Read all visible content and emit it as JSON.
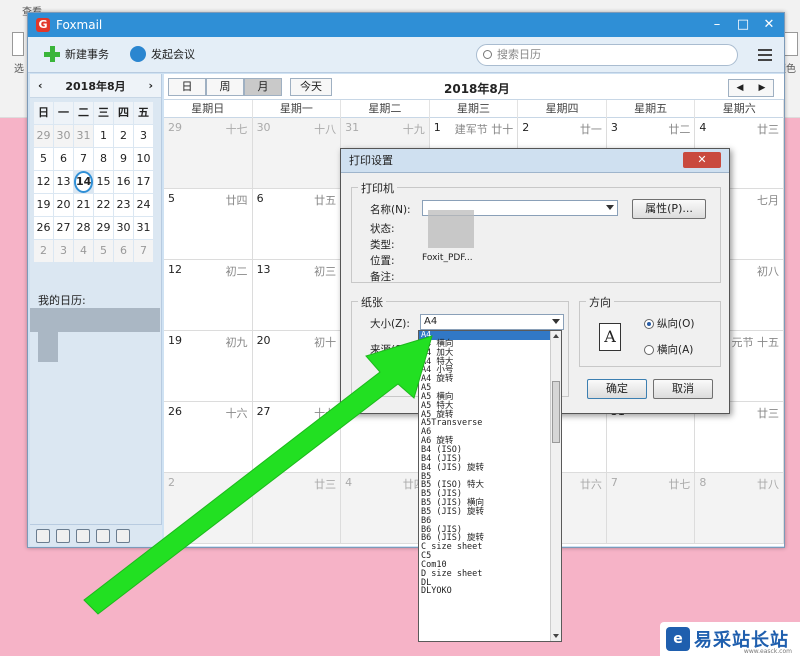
{
  "background_app": {
    "menu_label": "查看",
    "left_label": "选",
    "right_label": "颜色"
  },
  "window": {
    "title": "Foxmail"
  },
  "toolbar": {
    "new_event": "新建事务",
    "start_meeting": "发起会议",
    "search_placeholder": "搜索日历"
  },
  "mini_calendar": {
    "title": "2018年8月",
    "weekdays": [
      "日",
      "一",
      "二",
      "三",
      "四",
      "五",
      "六"
    ],
    "days": [
      [
        "29",
        "30",
        "31",
        "1",
        "2",
        "3",
        "4"
      ],
      [
        "5",
        "6",
        "7",
        "8",
        "9",
        "10",
        "11"
      ],
      [
        "12",
        "13",
        "14",
        "15",
        "16",
        "17",
        "18"
      ],
      [
        "19",
        "20",
        "21",
        "22",
        "23",
        "24",
        "25"
      ],
      [
        "26",
        "27",
        "28",
        "29",
        "30",
        "31",
        "1"
      ],
      [
        "2",
        "3",
        "4",
        "5",
        "6",
        "7",
        "8"
      ]
    ],
    "today": "14"
  },
  "my_calendars_label": "我的日历:",
  "view_bar": {
    "day": "日",
    "week": "周",
    "month": "月",
    "today": "今天",
    "title": "2018年8月"
  },
  "month_view": {
    "weekdays": [
      "星期日",
      "星期一",
      "星期二",
      "星期三",
      "星期四",
      "星期五",
      "星期六"
    ],
    "rows": [
      [
        {
          "d": "29",
          "l": "十七"
        },
        {
          "d": "30",
          "l": "十八"
        },
        {
          "d": "31",
          "l": "十九"
        },
        {
          "d": "1",
          "l": "建军节 廿十"
        },
        {
          "d": "2",
          "l": "廿一"
        },
        {
          "d": "3",
          "l": "廿二"
        },
        {
          "d": "4",
          "l": "廿三"
        }
      ],
      [
        {
          "d": "5",
          "l": "廿四"
        },
        {
          "d": "6",
          "l": "廿五"
        },
        {
          "d": "",
          "l": ""
        },
        {
          "d": "",
          "l": ""
        },
        {
          "d": "",
          "l": ""
        },
        {
          "d": "",
          "l": ""
        },
        {
          "d": "",
          "l": "七月"
        }
      ],
      [
        {
          "d": "12",
          "l": "初二"
        },
        {
          "d": "13",
          "l": "初三"
        },
        {
          "d": "",
          "l": ""
        },
        {
          "d": "",
          "l": ""
        },
        {
          "d": "",
          "l": ""
        },
        {
          "d": "",
          "l": ""
        },
        {
          "d": "",
          "l": "初八"
        }
      ],
      [
        {
          "d": "19",
          "l": "初九"
        },
        {
          "d": "20",
          "l": "初十"
        },
        {
          "d": "",
          "l": ""
        },
        {
          "d": "",
          "l": ""
        },
        {
          "d": "",
          "l": ""
        },
        {
          "d": "",
          "l": ""
        },
        {
          "d": "",
          "l": "元节 十五"
        }
      ],
      [
        {
          "d": "26",
          "l": "十六"
        },
        {
          "d": "27",
          "l": "十七"
        },
        {
          "d": "",
          "l": ""
        },
        {
          "d": "",
          "l": ""
        },
        {
          "d": "",
          "l": ""
        },
        {
          "d": "31",
          "l": ""
        },
        {
          "d": "",
          "l": "廿三"
        }
      ],
      [
        {
          "d": "2",
          "l": ""
        },
        {
          "d": "3",
          "l": "廿三"
        },
        {
          "d": "4",
          "l": "廿四"
        },
        {
          "d": "5",
          "l": "廿五"
        },
        {
          "d": "6",
          "l": "廿六"
        },
        {
          "d": "7",
          "l": "廿七"
        },
        {
          "d": "8",
          "l": "廿八"
        }
      ]
    ]
  },
  "print_dialog": {
    "title": "打印设置",
    "printer_group": "打印机",
    "name_label": "名称(N):",
    "status_label": "状态:",
    "type_label": "类型:",
    "location_label": "位置:",
    "location_value": "Foxit_PDF...",
    "comment_label": "备注:",
    "properties_button": "属性(P)...",
    "paper_group": "纸张",
    "size_label": "大小(Z):",
    "size_value": "A4",
    "source_label": "来源(S):",
    "orientation_group": "方向",
    "portrait": "纵向(O)",
    "landscape": "横向(A)",
    "ok": "确定",
    "cancel": "取消"
  },
  "paper_sizes": [
    "A4",
    "A4 横向",
    "A4 加大",
    "A4 特大",
    "A4 小号",
    "A4 旋转",
    "A5",
    "A5 横向",
    "A5 特大",
    "A5 旋转",
    "A5Transverse",
    "A6",
    "A6 旋转",
    "B4 (ISO)",
    "B4 (JIS)",
    "B4 (JIS) 旋转",
    "B5",
    "B5 (ISO) 特大",
    "B5 (JIS)",
    "B5 (JIS) 横向",
    "B5 (JIS) 旋转",
    "B6",
    "B6 (JIS)",
    "B6 (JIS) 旋转",
    "C size sheet",
    "C5",
    "Com10",
    "D size sheet",
    "DL",
    "DLYOKO"
  ],
  "watermark": {
    "text": "易采站长站",
    "url": "www.easck.com"
  },
  "colors": {
    "accent": "#2f8fd6",
    "highlight": "#3178c6",
    "arrow": "#22e022",
    "background": "#f6b3c7"
  }
}
